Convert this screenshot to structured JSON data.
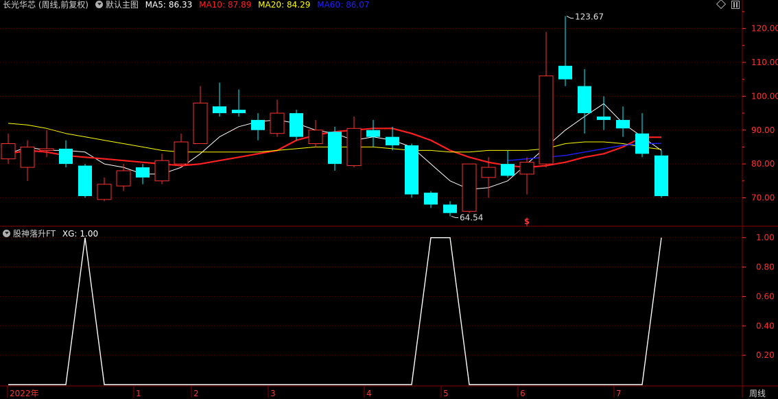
{
  "header": {
    "title": "长光华芯 (周线,前复权)",
    "template": "默认主图",
    "ma": [
      {
        "label": "MA5:",
        "value": "86.33",
        "color": "#ffffff"
      },
      {
        "label": "MA10:",
        "value": "87.89",
        "color": "#ff2020"
      },
      {
        "label": "MA20:",
        "value": "84.29",
        "color": "#ffff00"
      },
      {
        "label": "MA60:",
        "value": "86.07",
        "color": "#2020ff"
      }
    ]
  },
  "indicator_header": {
    "name": "股神落升FT",
    "xg_label": "XG:",
    "xg_value": "1.00"
  },
  "period_label": "周线",
  "colors": {
    "background": "#000000",
    "frame": "#8b0000",
    "up": "#ff3232",
    "down": "#00ffff",
    "axis_text": "#ff3232",
    "ma5": "#ffffff",
    "ma10": "#ff2020",
    "ma20": "#ffff00",
    "ma60": "#2020ff"
  },
  "chart_data": [
    {
      "type": "candlestick",
      "title": "长光华芯 (周线,前复权)",
      "ylim": [
        62,
        126
      ],
      "yticks": [
        70,
        80,
        90,
        100,
        110,
        120
      ],
      "ytick_labels": [
        "70.00",
        "80.00",
        "90.00",
        "100.00",
        "110.00",
        "120.00"
      ],
      "x_time_labels": [
        "2022年",
        "1",
        "2",
        "3",
        "4",
        "5",
        "6",
        "7"
      ],
      "annotations": [
        {
          "text": "123.67",
          "index": 29,
          "value": 123.67
        },
        {
          "text": "64.54",
          "index": 23,
          "value": 64.54
        },
        {
          "text": "S",
          "index": 27
        }
      ],
      "candles": [
        {
          "o": 81.5,
          "c": 86,
          "h": 89,
          "l": 80
        },
        {
          "o": 79,
          "c": 85,
          "h": 87,
          "l": 75
        },
        {
          "o": 84,
          "c": 84.5,
          "h": 90,
          "l": 82
        },
        {
          "o": 84.5,
          "c": 80,
          "h": 87,
          "l": 79
        },
        {
          "o": 79.5,
          "c": 70.5,
          "h": 80,
          "l": 70
        },
        {
          "o": 69.5,
          "c": 74,
          "h": 76,
          "l": 69
        },
        {
          "o": 73.5,
          "c": 78,
          "h": 80,
          "l": 72
        },
        {
          "o": 79,
          "c": 76,
          "h": 80,
          "l": 74
        },
        {
          "o": 75,
          "c": 81,
          "h": 83,
          "l": 74
        },
        {
          "o": 80,
          "c": 86.5,
          "h": 89,
          "l": 79
        },
        {
          "o": 86,
          "c": 98,
          "h": 103,
          "l": 86
        },
        {
          "o": 97,
          "c": 95,
          "h": 104,
          "l": 94
        },
        {
          "o": 96,
          "c": 95,
          "h": 102,
          "l": 94
        },
        {
          "o": 93,
          "c": 90,
          "h": 95,
          "l": 87
        },
        {
          "o": 89,
          "c": 95,
          "h": 99,
          "l": 88
        },
        {
          "o": 95,
          "c": 88,
          "h": 96,
          "l": 87
        },
        {
          "o": 86,
          "c": 90,
          "h": 93,
          "l": 85
        },
        {
          "o": 89.5,
          "c": 80,
          "h": 91,
          "l": 78
        },
        {
          "o": 79.5,
          "c": 90.5,
          "h": 94,
          "l": 79
        },
        {
          "o": 90,
          "c": 88,
          "h": 93,
          "l": 85
        },
        {
          "o": 88,
          "c": 85.5,
          "h": 91,
          "l": 84
        },
        {
          "o": 85.5,
          "c": 71,
          "h": 86,
          "l": 70
        },
        {
          "o": 71.5,
          "c": 68,
          "h": 72,
          "l": 67
        },
        {
          "o": 68,
          "c": 65.5,
          "h": 69,
          "l": 64.54
        },
        {
          "o": 66,
          "c": 80,
          "h": 80,
          "l": 65.5
        },
        {
          "o": 76,
          "c": 79,
          "h": 82,
          "l": 70
        },
        {
          "o": 80,
          "c": 76.5,
          "h": 84,
          "l": 76
        },
        {
          "o": 77,
          "c": 80.5,
          "h": 82,
          "l": 71
        },
        {
          "o": 80,
          "c": 106,
          "h": 119,
          "l": 79
        },
        {
          "o": 109,
          "c": 105,
          "h": 123.67,
          "l": 103
        },
        {
          "o": 103,
          "c": 95,
          "h": 108,
          "l": 89
        },
        {
          "o": 94,
          "c": 93,
          "h": 100,
          "l": 90
        },
        {
          "o": 93,
          "c": 90.5,
          "h": 97,
          "l": 88
        },
        {
          "o": 89,
          "c": 83,
          "h": 95,
          "l": 82
        },
        {
          "o": 82.5,
          "c": 70.5,
          "h": 84,
          "l": 70
        }
      ],
      "series": [
        {
          "name": "MA5",
          "color": "#ffffff",
          "start": 0,
          "values": [
            83,
            85,
            84,
            84,
            83.5,
            80,
            79,
            77,
            77,
            79,
            83,
            88,
            91,
            92.5,
            93,
            92,
            90,
            89,
            87,
            88,
            87,
            85,
            80,
            75,
            72.5,
            73,
            75,
            80,
            85,
            90,
            94,
            97.8,
            92,
            88,
            84
          ]
        },
        {
          "name": "MA10",
          "color": "#ff2020",
          "start": 0,
          "values": [
            83,
            84,
            83.5,
            82.5,
            82,
            81.5,
            81,
            80.5,
            80,
            79.5,
            80,
            81,
            82,
            83,
            84,
            87,
            88.5,
            89.5,
            90,
            90.5,
            90.5,
            89,
            87,
            84,
            82,
            80.5,
            79.5,
            79,
            79.5,
            80.5,
            82,
            83,
            85,
            87.89,
            87.89
          ]
        },
        {
          "name": "MA20",
          "color": "#ffff00",
          "start": 0,
          "values": [
            92,
            91.5,
            90.5,
            89,
            88,
            87,
            86,
            85,
            84,
            83.5,
            83.5,
            83.5,
            83.5,
            83.5,
            84,
            84.5,
            85,
            85,
            85,
            85,
            84.5,
            84,
            84,
            83.5,
            83.5,
            84,
            84,
            84,
            84.5,
            86,
            86.5,
            86.5,
            86,
            85,
            84.29
          ]
        },
        {
          "name": "MA60",
          "color": "#2020ff",
          "start": 26,
          "values": [
            81,
            81.5,
            82,
            82.5,
            83.5,
            84.5,
            85.5,
            86,
            86.07
          ]
        }
      ]
    },
    {
      "type": "line",
      "title": "股神落升FT",
      "ylim": [
        0,
        1.05
      ],
      "yticks": [
        0.2,
        0.4,
        0.6,
        0.8,
        1.0
      ],
      "ytick_labels": [
        "0.20",
        "0.40",
        "0.60",
        "0.80",
        "1.00"
      ],
      "series": [
        {
          "name": "XG",
          "color": "#ffffff",
          "values": [
            0,
            0,
            0,
            0,
            1,
            0,
            0,
            0,
            0,
            0,
            0,
            0,
            0,
            0,
            0,
            0,
            0,
            0,
            0,
            0,
            0,
            0,
            1,
            1,
            0,
            0,
            0,
            0,
            0,
            0,
            0,
            0,
            0,
            0,
            1
          ]
        }
      ]
    }
  ]
}
